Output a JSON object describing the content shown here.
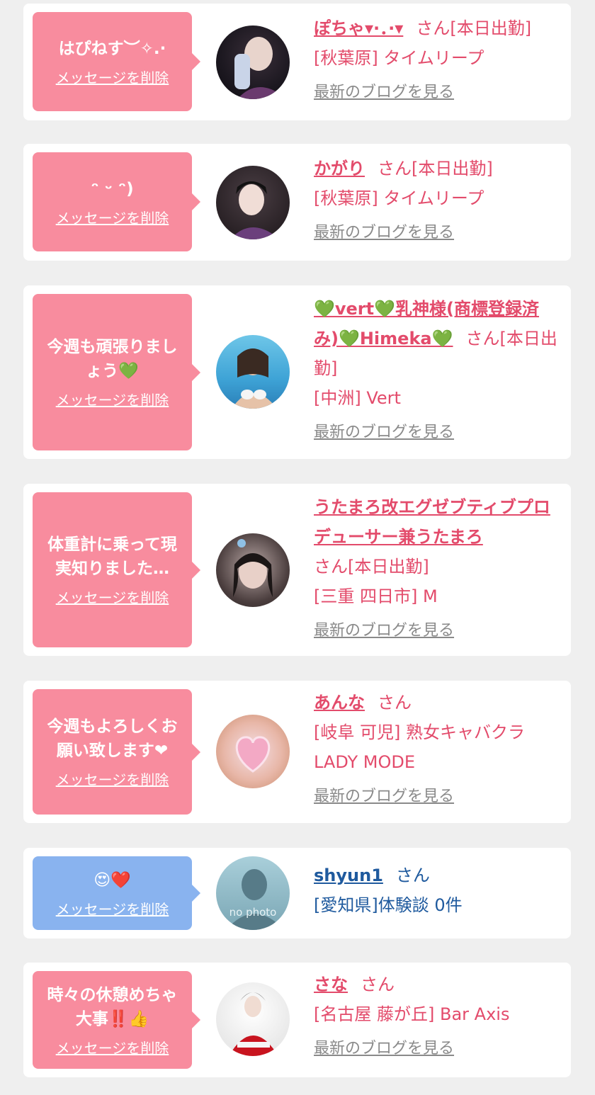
{
  "common": {
    "delete_label": "メッセージを削除",
    "blog_label": "最新のブログを見る",
    "san": "さん"
  },
  "cards": [
    {
      "message": "はぴねす︶✧.·",
      "name": "ぽちゃ▾·．·▾",
      "status": "[本日出勤]",
      "shop": "[秋葉原] タイムリープ",
      "theme": "pink"
    },
    {
      "message": "ᵔ ᵕ ᵔ)",
      "name": "かがり",
      "status": "[本日出勤]",
      "shop": "[秋葉原] タイムリープ",
      "theme": "pink"
    },
    {
      "message": "今週も頑張りましょう💚",
      "name": "💚vert💚乳神様(商標登録済み)💚Himeka💚",
      "status": "[本日出勤]",
      "shop": "[中洲] Vert",
      "theme": "pink"
    },
    {
      "message": "体重計に乗って現実知りました…",
      "name": "うたまろ改エグゼブティブプロデューサー兼うたまろ",
      "status": "[本日出勤]",
      "shop": "[三重 四日市] M",
      "theme": "pink"
    },
    {
      "message": "今週もよろしくお願い致します❤",
      "name": "あんな",
      "status": "",
      "shop": "[岐阜 可児] 熟女キャバクラLADY MODE",
      "theme": "pink"
    },
    {
      "message": "😍❤️",
      "name": "shyun1",
      "status": "",
      "shop": "[愛知県]体験談 0件",
      "avatar_text": "no photo",
      "theme": "blue"
    },
    {
      "message": "時々の休憩めちゃ大事‼️👍",
      "name": "さな",
      "status": "",
      "shop": "[名古屋 藤が丘] Bar Axis",
      "theme": "pink"
    }
  ]
}
